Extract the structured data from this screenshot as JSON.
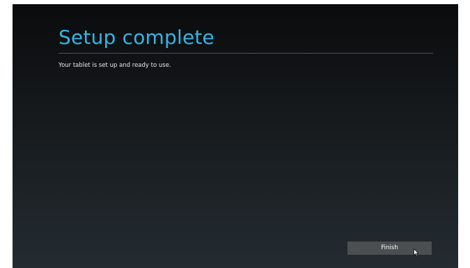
{
  "screen": {
    "title": "Setup complete",
    "message": "Your tablet is set up and ready to use.",
    "finish_label": "Finish"
  },
  "colors": {
    "accent": "#33b5e5",
    "background_top": "#0a0b0c",
    "background_bottom": "#242b31",
    "button": "#4b4f52"
  },
  "icons": {
    "cursor": "mouse-pointer-icon"
  }
}
